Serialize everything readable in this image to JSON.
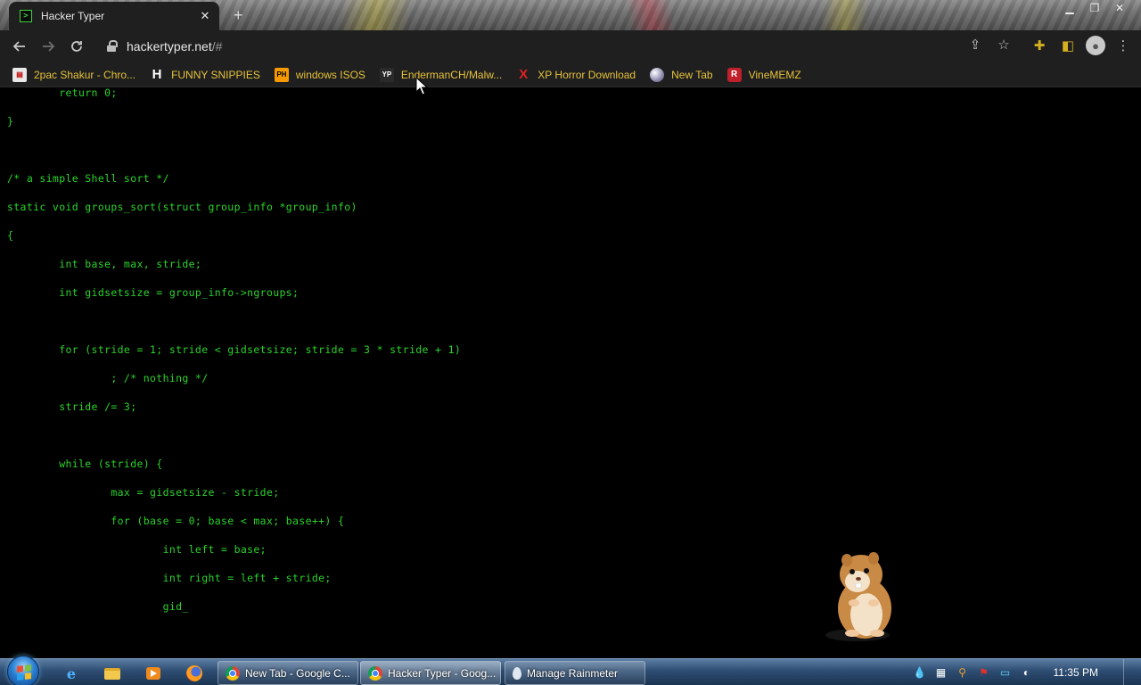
{
  "browser": {
    "tab_title": "Hacker Typer",
    "tab_favicon": ">",
    "tab_close": "✕",
    "new_tab": "+",
    "url_host": "hackertyper.net",
    "url_rest": "/#"
  },
  "bookmarks": [
    {
      "label": "2pac Shakur - Chro...",
      "icon": "2pac-favicon"
    },
    {
      "label": "FUNNY SNIPPIES",
      "icon": "h-favicon"
    },
    {
      "label": "windows ISOS",
      "icon": "ph-favicon"
    },
    {
      "label": "EndermanCH/Malw...",
      "icon": "yp-favicon"
    },
    {
      "label": "XP Horror Download",
      "icon": "x-favicon"
    },
    {
      "label": "New Tab",
      "icon": "ball-favicon"
    },
    {
      "label": "VineMEMZ",
      "icon": "r-favicon"
    }
  ],
  "code_lines": [
    "        return 0;",
    "}",
    "",
    "/* a simple Shell sort */",
    "static void groups_sort(struct group_info *group_info)",
    "{",
    "        int base, max, stride;",
    "        int gidsetsize = group_info->ngroups;",
    "",
    "        for (stride = 1; stride < gidsetsize; stride = 3 * stride + 1)",
    "                ; /* nothing */",
    "        stride /= 3;",
    "",
    "        while (stride) {",
    "                max = gidsetsize - stride;",
    "                for (base = 0; base < max; base++) {",
    "                        int left = base;",
    "                        int right = left + stride;",
    "                        gid_"
  ],
  "taskbar": {
    "tasks": [
      {
        "label": "New Tab - Google C..."
      },
      {
        "label": "Hacker Typer - Goog..."
      },
      {
        "label": "Manage Rainmeter"
      }
    ],
    "clock": "11:35 PM"
  },
  "colors": {
    "code_green": "#2bd32b",
    "bookmark_text": "#e6c23a",
    "browser_chrome": "#1f1f1f",
    "page_background": "#000000"
  }
}
